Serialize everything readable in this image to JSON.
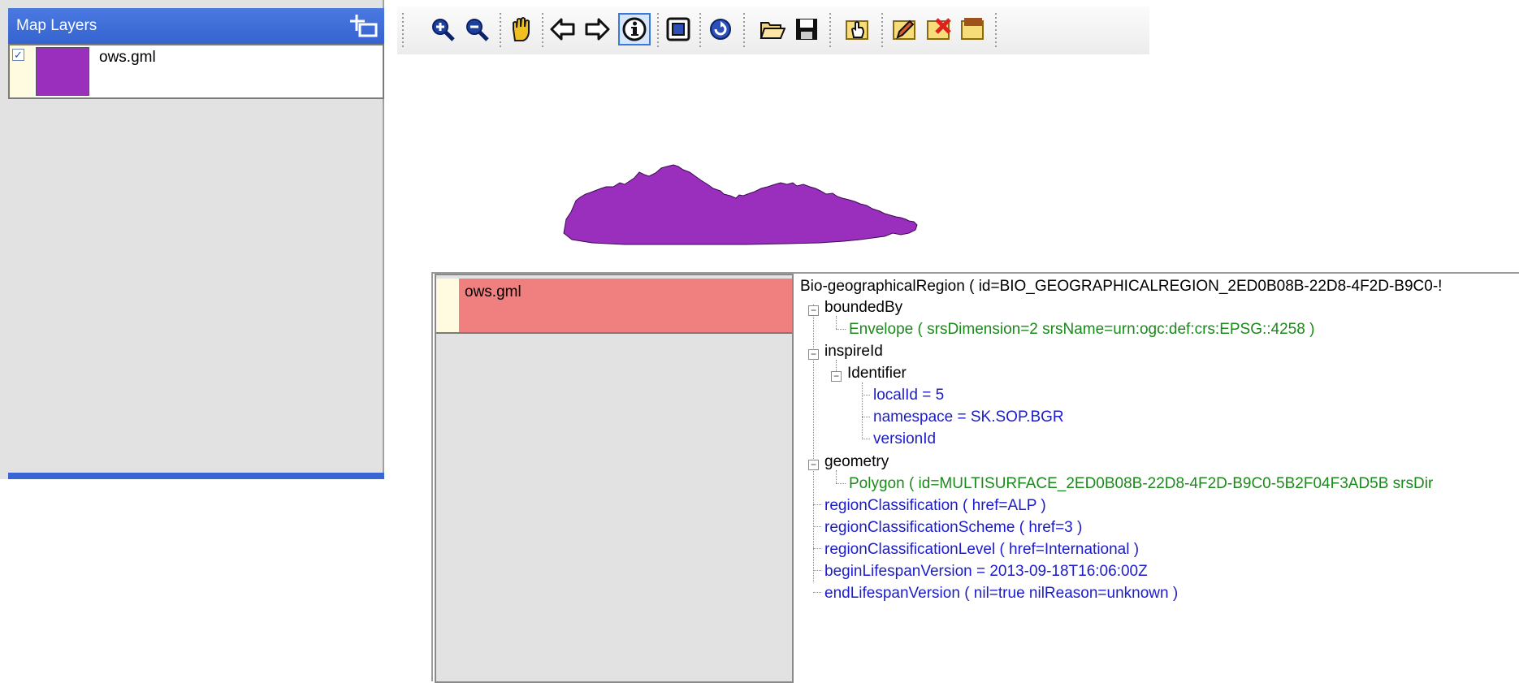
{
  "layers_panel": {
    "title": "Map Layers",
    "layer": {
      "name": "ows.gml",
      "checked": true,
      "color": "#9b2fbd"
    }
  },
  "toolbar": {
    "buttons": [
      {
        "icon": "zoom-in-icon"
      },
      {
        "icon": "zoom-out-icon"
      },
      {
        "icon": "pan-hand-icon"
      },
      {
        "icon": "back-arrow-icon"
      },
      {
        "icon": "forward-arrow-icon"
      },
      {
        "icon": "info-icon",
        "active": true
      },
      {
        "icon": "zoom-extent-icon"
      },
      {
        "icon": "refresh-icon"
      },
      {
        "icon": "open-folder-icon"
      },
      {
        "icon": "save-disk-icon"
      },
      {
        "icon": "select-layer-icon"
      },
      {
        "icon": "edit-pencil-icon"
      },
      {
        "icon": "delete-layer-icon"
      },
      {
        "icon": "edit-badge-icon"
      }
    ]
  },
  "map": {
    "polygon_color": "#9b2fbd"
  },
  "info_popup": {
    "layer_name": "ows.gml",
    "tree": {
      "root": "Bio-geographicalRegion ( id=BIO_GEOGRAPHICALREGION_2ED0B08B-22D8-4F2D-B9C0-!",
      "bounded_by": "boundedBy",
      "envelope": "Envelope ( srsDimension=2 srsName=urn:ogc:def:crs:EPSG::4258 )",
      "inspire_id": "inspireId",
      "identifier": "Identifier",
      "local_id": "localId = 5",
      "namespace": "namespace = SK.SOP.BGR",
      "version_id": "versionId",
      "geometry": "geometry",
      "polygon": "Polygon ( id=MULTISURFACE_2ED0B08B-22D8-4F2D-B9C0-5B2F04F3AD5B srsDir",
      "region_classification": "regionClassification ( href=ALP )",
      "region_classification_scheme": "regionClassificationScheme ( href=3 )",
      "region_classification_level": "regionClassificationLevel ( href=International )",
      "begin_lifespan": "beginLifespanVersion = 2013-09-18T16:06:00Z",
      "end_lifespan": "endLifespanVersion ( nil=true nilReason=unknown )"
    }
  }
}
